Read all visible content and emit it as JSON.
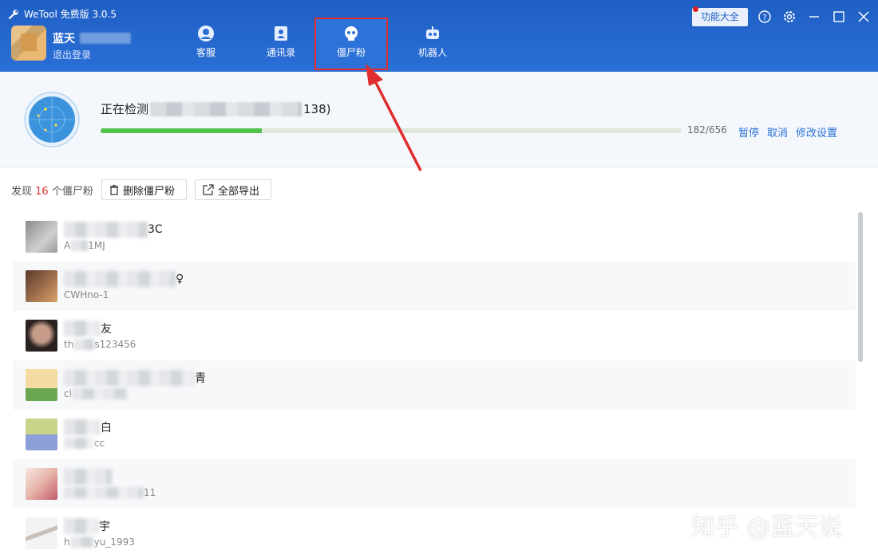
{
  "app": {
    "title": "WeTool 免费版 3.0.5"
  },
  "user": {
    "name": "蓝天",
    "logout_label": "退出登录"
  },
  "nav": {
    "tabs": [
      {
        "label": "客服",
        "icon": "headset-icon"
      },
      {
        "label": "通讯录",
        "icon": "contacts-icon"
      },
      {
        "label": "僵尸粉",
        "icon": "skull-icon",
        "active": true
      },
      {
        "label": "机器人",
        "icon": "robot-icon"
      }
    ]
  },
  "header": {
    "feature_button": "功能大全"
  },
  "status": {
    "detect_prefix": "正在检测",
    "detect_suffix": "138)",
    "progress_count": "182/656",
    "progress_fraction": 0.2775,
    "pause_label": "暂停",
    "cancel_label": "取消",
    "settings_label": "修改设置"
  },
  "toolbar": {
    "found_prefix": "发现",
    "found_count": "16",
    "found_suffix": "个僵尸粉",
    "delete_label": "删除僵尸粉",
    "export_label": "全部导出"
  },
  "contacts": [
    {
      "name_tail": "3C",
      "sub_head": "A",
      "sub_tail": "1MJ"
    },
    {
      "name_tail": "♀",
      "sub_head": "",
      "sub_tail": "CWHno-1"
    },
    {
      "name_tail": "友",
      "sub_head": "th",
      "sub_tail": "s123456"
    },
    {
      "name_tail": "青",
      "sub_head": "cl",
      "sub_tail": ""
    },
    {
      "name_tail": "白",
      "sub_head": "",
      "sub_tail": "cc"
    },
    {
      "name_tail": "",
      "sub_head": "",
      "sub_tail": "11"
    },
    {
      "name_tail": "宇",
      "sub_head": "h",
      "sub_tail": "yu_1993"
    }
  ],
  "watermark": "知乎 @蓝天说",
  "colors": {
    "header": "#1f5fc4",
    "accent": "#2a6fd6",
    "progress": "#4fc34a",
    "highlight": "#e02d2d"
  }
}
